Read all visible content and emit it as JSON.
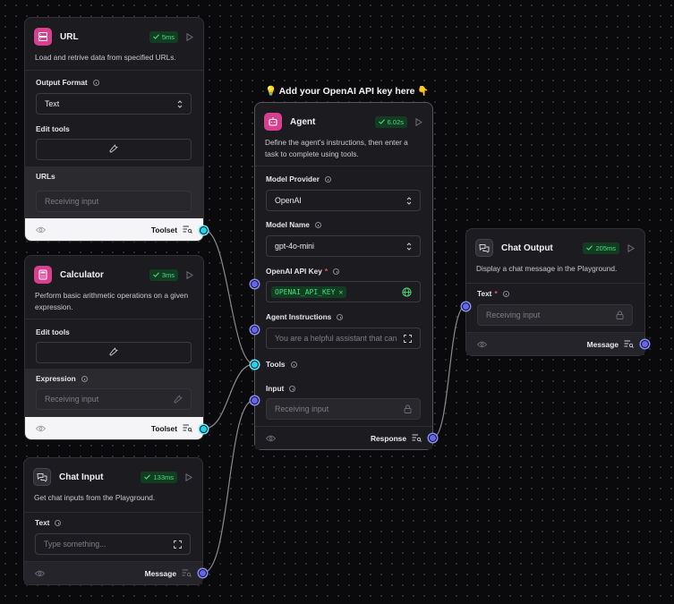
{
  "canvas_note": "💡 Add your OpenAI API key here 👇",
  "url_node": {
    "title": "URL",
    "time": "5ms",
    "description": "Load and retrive data from specified URLs.",
    "output_format_label": "Output Format",
    "output_format_value": "Text",
    "edit_tools_label": "Edit tools",
    "urls_label": "URLs",
    "urls_placeholder": "Receiving input",
    "footer_label": "Toolset"
  },
  "calculator_node": {
    "title": "Calculator",
    "time": "3ms",
    "description": "Perform basic arithmetic operations on a given expression.",
    "edit_tools_label": "Edit tools",
    "expression_label": "Expression",
    "expression_placeholder": "Receiving input",
    "footer_label": "Toolset"
  },
  "chat_input_node": {
    "title": "Chat Input",
    "time": "133ms",
    "description": "Get chat inputs from the Playground.",
    "text_label": "Text",
    "text_placeholder": "Type something...",
    "footer_label": "Message"
  },
  "agent_node": {
    "title": "Agent",
    "time": "6.02s",
    "description": "Define the agent's instructions, then enter a task to complete using tools.",
    "model_provider_label": "Model Provider",
    "model_provider_value": "OpenAI",
    "model_name_label": "Model Name",
    "model_name_value": "gpt-4o-mini",
    "api_key_label": "OpenAI API Key",
    "api_key_required": "*",
    "api_key_value": "OPENAI_API_KEY",
    "instructions_label": "Agent Instructions",
    "instructions_value": "You are a helpful assistant that can",
    "tools_label": "Tools",
    "input_label": "Input",
    "input_placeholder": "Receiving input",
    "footer_label": "Response"
  },
  "chat_output_node": {
    "title": "Chat Output",
    "time": "205ms",
    "description": "Display a chat message in the Playground.",
    "text_label": "Text",
    "text_required": "*",
    "text_placeholder": "Receiving input",
    "footer_label": "Message"
  },
  "colors": {
    "canvas": "#0a0a0c",
    "node": "#1c1c20",
    "accent_pink": "#d6408f",
    "edge": "#8a8a90",
    "handle_blue": "#6366f1",
    "handle_cyan": "#22d3ee",
    "badge_green": "#4ade80"
  }
}
